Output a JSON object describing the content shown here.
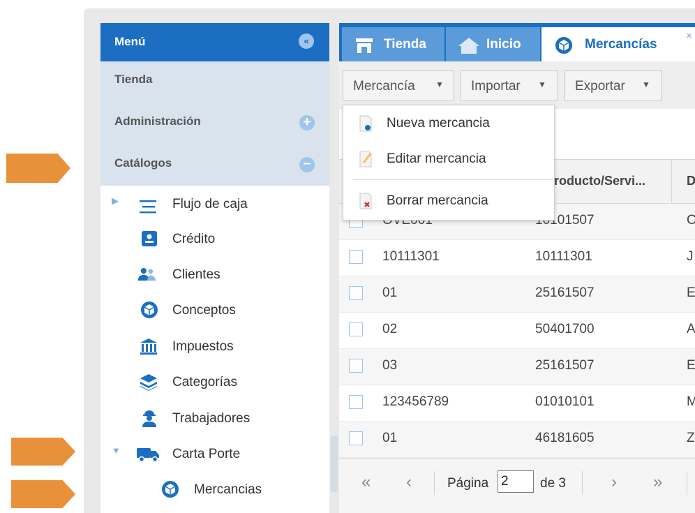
{
  "sidebar": {
    "title": "Menú",
    "sections": [
      {
        "label": "Tienda"
      },
      {
        "label": "Administración"
      },
      {
        "label": "Catálogos"
      }
    ],
    "tree": [
      {
        "label": "Flujo de caja",
        "icon": "menu-lines-icon"
      },
      {
        "label": "Crédito",
        "icon": "id-card-icon"
      },
      {
        "label": "Clientes",
        "icon": "users-icon"
      },
      {
        "label": "Conceptos",
        "icon": "box-icon"
      },
      {
        "label": "Impuestos",
        "icon": "bank-icon"
      },
      {
        "label": "Categorías",
        "icon": "layers-icon"
      },
      {
        "label": "Trabajadores",
        "icon": "worker-icon"
      },
      {
        "label": "Carta Porte",
        "icon": "truck-icon"
      },
      {
        "label": "Mercancias",
        "icon": "box-icon"
      }
    ]
  },
  "tabs": [
    {
      "label": "Tienda",
      "icon": "store-icon"
    },
    {
      "label": "Inicio",
      "icon": "home-icon"
    },
    {
      "label": "Mercancías",
      "icon": "box-icon",
      "close": "×"
    }
  ],
  "toolbar": {
    "mercancia": "Mercancía",
    "importar": "Importar",
    "exportar": "Exportar"
  },
  "dropdown": {
    "items": [
      {
        "label": "Nueva mercancia",
        "icon": "new-document-icon"
      },
      {
        "label": "Editar mercancia",
        "icon": "edit-document-icon"
      },
      {
        "label": "Borrar mercancia",
        "icon": "delete-document-icon"
      }
    ]
  },
  "grid": {
    "headers": [
      "roducto/Servi...",
      "D"
    ],
    "rows": [
      [
        "OVE001",
        "10101507",
        "C"
      ],
      [
        "10111301",
        "10111301",
        "J"
      ],
      [
        "01",
        "25161507",
        "E"
      ],
      [
        "02",
        "50401700",
        "A"
      ],
      [
        "03",
        "25161507",
        "E"
      ],
      [
        "123456789",
        "01010101",
        "M"
      ],
      [
        "01",
        "46181605",
        "Z"
      ]
    ]
  },
  "pager": {
    "page_label": "Página",
    "page_value": "2",
    "of_label": "de 3"
  },
  "colors": {
    "primary": "#1b6ec2",
    "arrow": "#e8913a",
    "section": "#d9e3ee"
  }
}
